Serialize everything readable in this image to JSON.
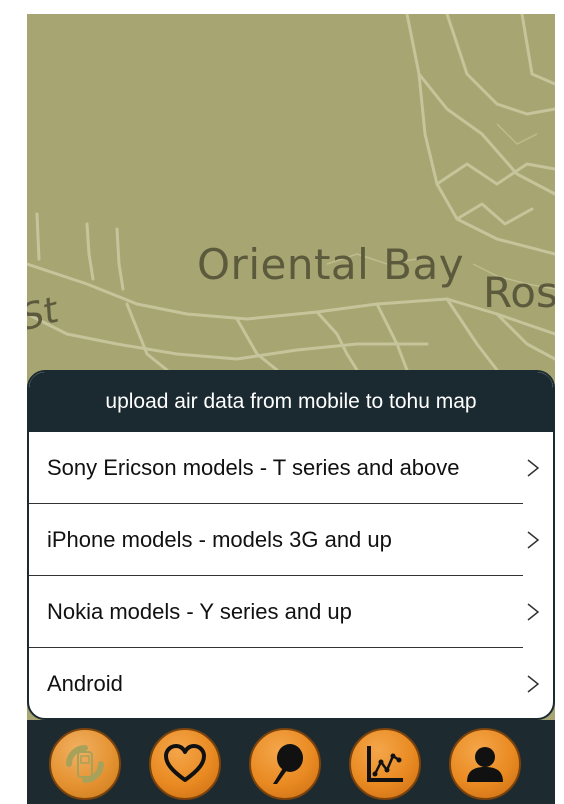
{
  "map": {
    "labels": {
      "oriental_bay": "Oriental Bay",
      "ros": "Ros",
      "st": "St"
    }
  },
  "panel": {
    "title": "upload air data from mobile to tohu map",
    "items": [
      {
        "label": "Sony Ericson models - T series and above"
      },
      {
        "label": "iPhone models - models 3G and up"
      },
      {
        "label": "Nokia models - Y series and up"
      },
      {
        "label": "Android"
      }
    ]
  },
  "tabbar": {
    "tabs": [
      {
        "icon": "mobile-phone-icon",
        "active": true
      },
      {
        "icon": "heart-icon"
      },
      {
        "icon": "map-pin-icon"
      },
      {
        "icon": "line-chart-icon"
      },
      {
        "icon": "user-icon"
      }
    ]
  },
  "colors": {
    "map_bg": "#a7a572",
    "map_roads": "#c6c49a",
    "header_bg": "#1a2a30",
    "tabbar_bg": "#1d2b31",
    "accent_orange": "#e98a22"
  }
}
